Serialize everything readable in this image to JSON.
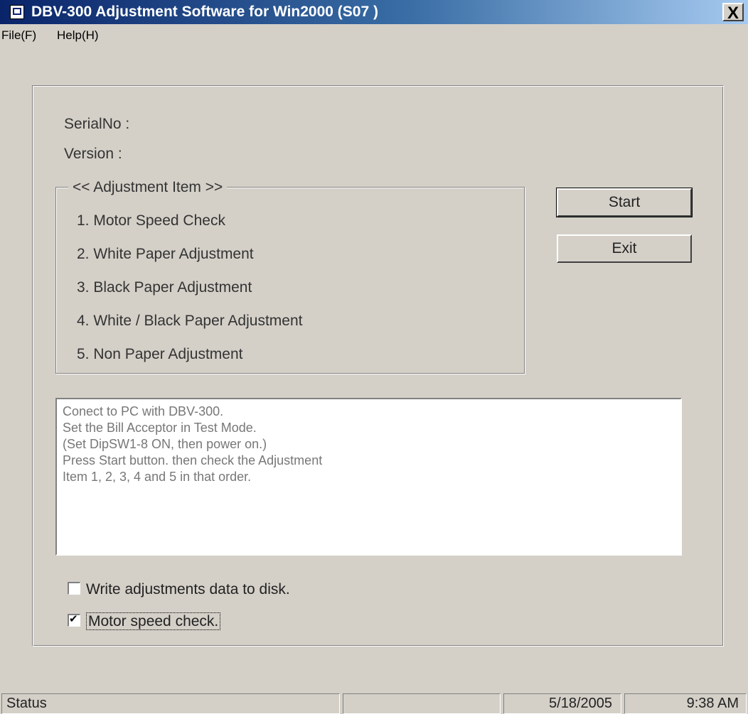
{
  "window": {
    "title": "DBV-300 Adjustment Software for Win2000 (S07 )",
    "close_label": "X"
  },
  "menu": {
    "items": [
      "File(F)",
      "Help(H)"
    ]
  },
  "info": {
    "serial_label": "SerialNo :",
    "version_label": "Version  :"
  },
  "adjustment_group": {
    "legend": "<< Adjustment Item >>",
    "items": [
      "1. Motor Speed Check",
      "2. White Paper Adjustment",
      "3. Black Paper Adjustment",
      "4. White / Black Paper Adjustment",
      "5. Non Paper Adjustment"
    ]
  },
  "buttons": {
    "start": "Start",
    "exit": "Exit"
  },
  "message": {
    "lines": [
      "Conect to PC with DBV-300.",
      "Set the Bill Acceptor in Test Mode.",
      "(Set DipSW1-8 ON, then power on.)",
      "Press Start button. then check the Adjustment",
      "Item 1, 2, 3, 4 and 5 in that order."
    ]
  },
  "options": {
    "write_data": {
      "label": "Write adjustments data to disk.",
      "checked": false
    },
    "motor_check": {
      "label": "Motor speed check.",
      "checked": true
    }
  },
  "status": {
    "text": "Status",
    "date": "5/18/2005",
    "time": "9:38 AM"
  }
}
